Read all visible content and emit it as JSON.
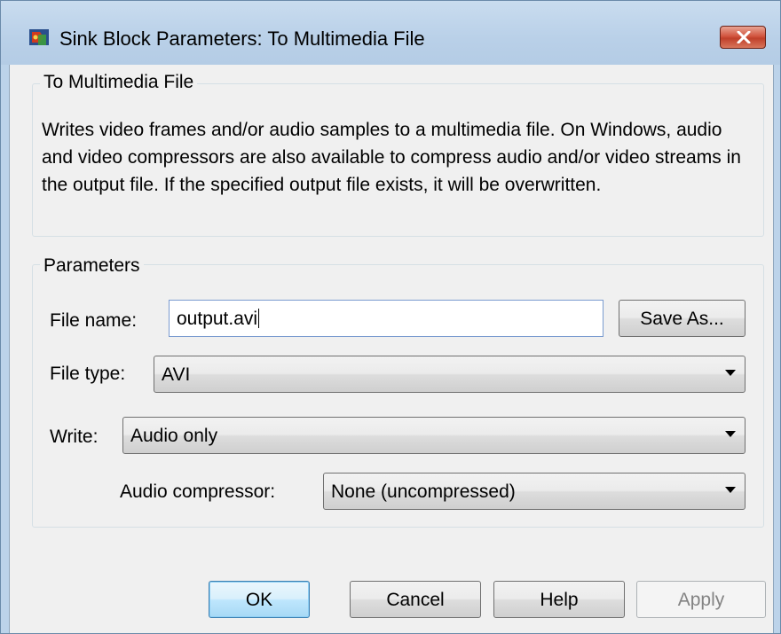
{
  "window": {
    "title": "Sink Block Parameters: To Multimedia File"
  },
  "block": {
    "group_title": "To Multimedia File",
    "description": "Writes video frames and/or audio samples to a multimedia file. On Windows, audio and video compressors are also available to compress audio and/or video streams in the output file. If the specified output file exists, it will be overwritten."
  },
  "parameters": {
    "group_title": "Parameters",
    "file_name_label": "File name:",
    "file_name_value": "output.avi",
    "save_as_label": "Save As...",
    "file_type_label": "File type:",
    "file_type_value": "AVI",
    "write_label": "Write:",
    "write_value": "Audio only",
    "audio_compressor_label": "Audio compressor:",
    "audio_compressor_value": "None (uncompressed)"
  },
  "buttons": {
    "ok": "OK",
    "cancel": "Cancel",
    "help": "Help",
    "apply": "Apply"
  },
  "icons": {
    "app": "simulink-block-icon",
    "close": "close-icon",
    "dropdown": "chevron-down-icon"
  }
}
